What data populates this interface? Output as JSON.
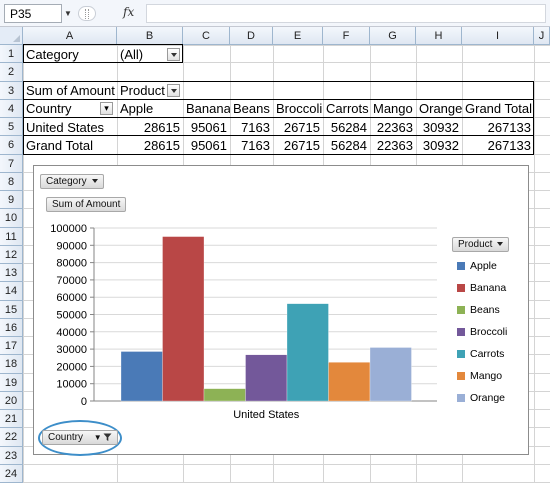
{
  "formula_bar": {
    "name_box": "P35",
    "fx_label": "fx",
    "formula": ""
  },
  "columns": [
    "A",
    "B",
    "C",
    "D",
    "E",
    "F",
    "G",
    "H",
    "I",
    "J"
  ],
  "rows": [
    "1",
    "2",
    "3",
    "4",
    "5",
    "6",
    "7",
    "8",
    "9",
    "10",
    "11",
    "12",
    "13",
    "14",
    "15",
    "16",
    "17",
    "18",
    "19",
    "20",
    "21",
    "22",
    "23",
    "24"
  ],
  "pivot": {
    "filter_label": "Category",
    "filter_value": "(All)",
    "values_label": "Sum of Amount",
    "column_field": "Product",
    "row_field": "Country",
    "headers": [
      "Apple",
      "Banana",
      "Beans",
      "Broccoli",
      "Carrots",
      "Mango",
      "Orange",
      "Grand Total"
    ],
    "rows": [
      {
        "label": "United States",
        "values": [
          "28615",
          "95061",
          "7163",
          "26715",
          "56284",
          "22363",
          "30932",
          "267133"
        ]
      },
      {
        "label": "Grand Total",
        "values": [
          "28615",
          "95061",
          "7163",
          "26715",
          "56284",
          "22363",
          "30932",
          "267133"
        ]
      }
    ]
  },
  "chart_buttons": {
    "category": "Category",
    "values": "Sum of Amount",
    "legend_field": "Product",
    "axis_field": "Country"
  },
  "chart_data": {
    "type": "bar",
    "categories": [
      "United States"
    ],
    "series": [
      {
        "name": "Apple",
        "values": [
          28615
        ],
        "color": "#4a7ab7"
      },
      {
        "name": "Banana",
        "values": [
          95061
        ],
        "color": "#b94746"
      },
      {
        "name": "Beans",
        "values": [
          7163
        ],
        "color": "#8db255"
      },
      {
        "name": "Broccoli",
        "values": [
          26715
        ],
        "color": "#73589a"
      },
      {
        "name": "Carrots",
        "values": [
          56284
        ],
        "color": "#3ea2b5"
      },
      {
        "name": "Mango",
        "values": [
          22363
        ],
        "color": "#e3883c"
      },
      {
        "name": "Orange",
        "values": [
          30932
        ],
        "color": "#9aafd6"
      }
    ],
    "ylim": [
      0,
      100000
    ],
    "yticks": [
      "0",
      "10000",
      "20000",
      "30000",
      "40000",
      "50000",
      "60000",
      "70000",
      "80000",
      "90000",
      "100000"
    ],
    "gridlines": true,
    "legend_position": "right"
  },
  "colors": {
    "accent_highlight": "#3d8ec9",
    "grid": "#d4d4d4"
  }
}
